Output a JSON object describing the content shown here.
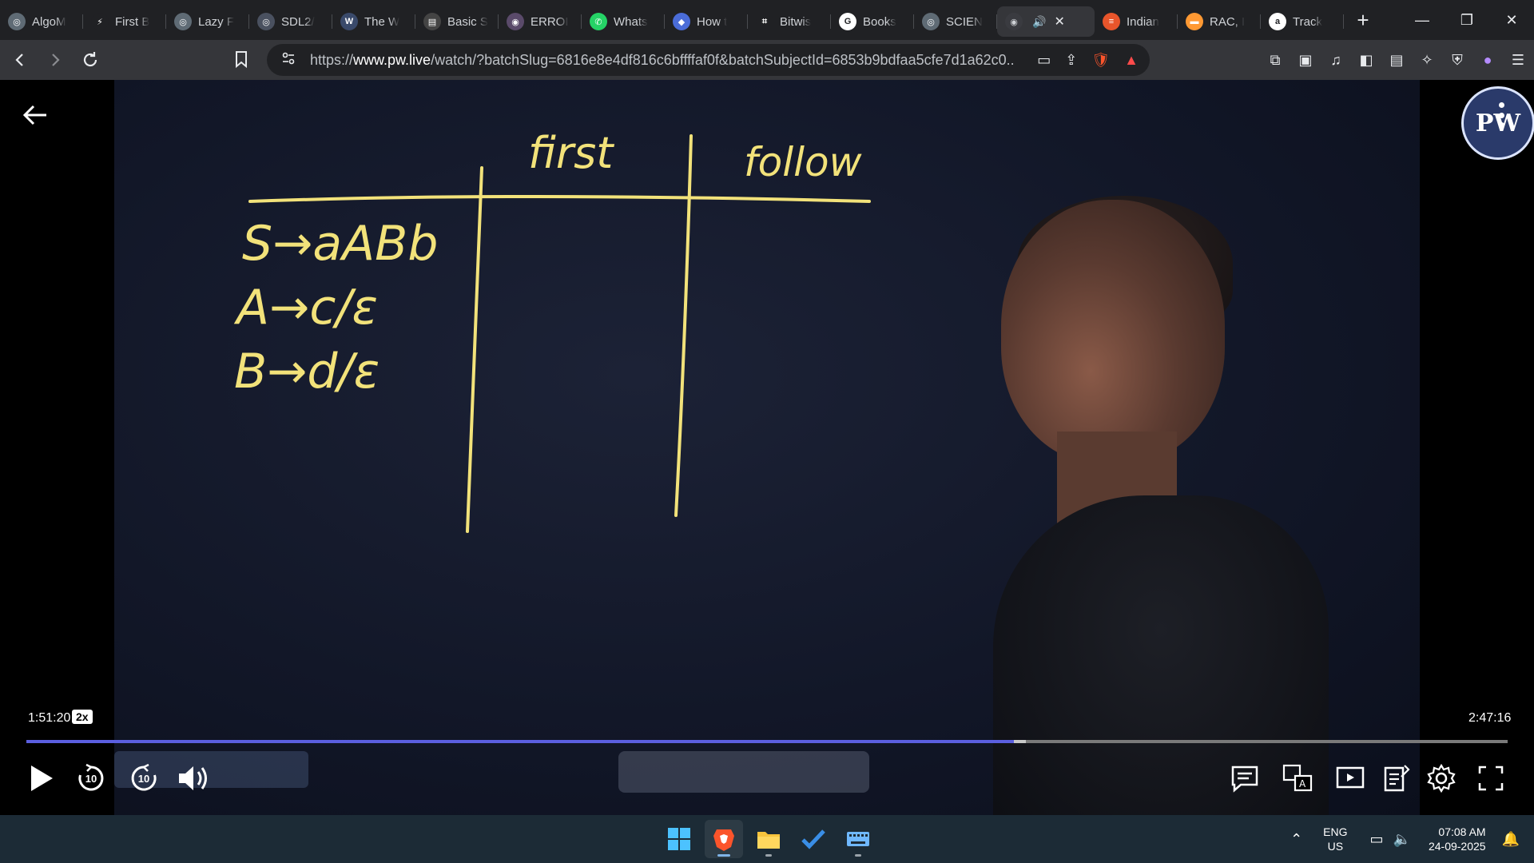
{
  "tabs": [
    {
      "title": "AlgoM",
      "fav_color": "#5f6b75",
      "fav_glyph": "◎"
    },
    {
      "title": "First B",
      "fav_color": "#202124",
      "fav_glyph": "⚡"
    },
    {
      "title": "Lazy F",
      "fav_color": "#5f6b75",
      "fav_glyph": "◎"
    },
    {
      "title": "SDL2/",
      "fav_color": "#4a5160",
      "fav_glyph": "◎"
    },
    {
      "title": "The W",
      "fav_color": "#3a4a6b",
      "fav_glyph": "W"
    },
    {
      "title": "Basic S",
      "fav_color": "#444",
      "fav_glyph": "▤"
    },
    {
      "title": "ERROI",
      "fav_color": "#5a4a6a",
      "fav_glyph": "◉"
    },
    {
      "title": "Whats",
      "fav_color": "#25d366",
      "fav_glyph": "✆"
    },
    {
      "title": "How t",
      "fav_color": "#4a6cd8",
      "fav_glyph": "◆"
    },
    {
      "title": "Bitwis",
      "fav_color": "#202124",
      "fav_glyph": "⌗"
    },
    {
      "title": "Books",
      "fav_color": "#ffffff",
      "fav_glyph": "G"
    },
    {
      "title": "SCIEN",
      "fav_color": "#5f6b75",
      "fav_glyph": "◎"
    }
  ],
  "active_tab": {
    "title": "",
    "audio_icon": "🔊",
    "close": "✕"
  },
  "tabs_after": [
    {
      "title": "Indian",
      "fav_color": "#e8552b",
      "fav_glyph": "≡"
    },
    {
      "title": "RAC, I",
      "fav_color": "#ff9933",
      "fav_glyph": "▬"
    },
    {
      "title": "Track",
      "fav_color": "#ffffff",
      "fav_glyph": "a"
    }
  ],
  "omnibox": {
    "url_prefix": "https://",
    "url_host": "www.pw.live",
    "url_path": "/watch/?batchSlug=6816e8e4df816c6bffffaf0f&batchSubjectId=6853b9bdfaa5cfe7d1a62c0..."
  },
  "video": {
    "current_time": "1:51:20",
    "speed": "2x",
    "total_time": "2:47:16",
    "progress_fraction": 0.6665,
    "buffer_fraction": 0.675,
    "skip_back_seconds": "10",
    "skip_forward_seconds": "10",
    "logo_text": "PW"
  },
  "board": {
    "col_first": "first",
    "col_follow": "follow",
    "rules": [
      "S→aABb",
      "A→c/ε",
      "B→d/ε"
    ],
    "ink_color": "#f2e27a"
  },
  "taskbar": {
    "lang_top": "ENG",
    "lang_bottom": "US",
    "time": "07:08 AM",
    "date": "24-09-2025"
  }
}
